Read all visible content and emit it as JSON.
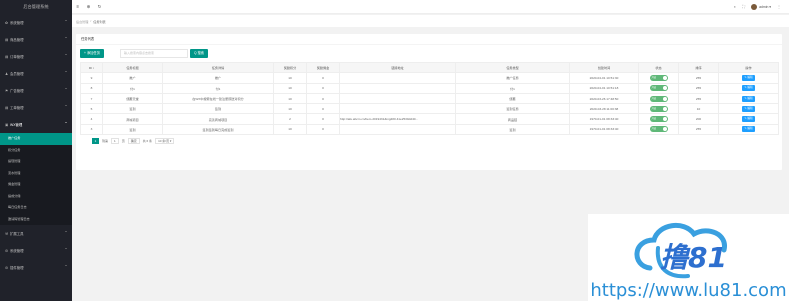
{
  "sidebar": {
    "logo": "后台管理系统",
    "items": [
      {
        "label": "系统管理",
        "icon": "gear-icon",
        "glyph": "✿"
      },
      {
        "label": "商品管理",
        "icon": "chart-icon",
        "glyph": "▤"
      },
      {
        "label": "订单管理",
        "icon": "order-icon",
        "glyph": "▤"
      },
      {
        "label": "会员管理",
        "icon": "user-icon",
        "glyph": "♟"
      },
      {
        "label": "广告管理",
        "icon": "flag-icon",
        "glyph": "⚑"
      },
      {
        "label": "工单管理",
        "icon": "ticket-icon",
        "glyph": "▤"
      },
      {
        "label": "WX管理",
        "icon": "wechat-icon",
        "glyph": "▣"
      }
    ],
    "sub_items": [
      "推广任务",
      "积分任务",
      "提现管理",
      "流水管理",
      "佣金管理",
      "提成分佣",
      "每日任务日志",
      "邀请码管理日志"
    ],
    "items_after": [
      {
        "label": "扩展工具",
        "icon": "wrench-icon",
        "glyph": "⚒"
      },
      {
        "label": "系统管理",
        "icon": "settings-icon",
        "glyph": "⚙"
      },
      {
        "label": "插件管理",
        "icon": "plugin-icon",
        "glyph": "⚙"
      }
    ]
  },
  "header": {
    "menu_icon": "≡",
    "globe_icon": "⊕",
    "refresh_icon": "↻",
    "right_icon1": "◐",
    "right_icon2": "⛶",
    "user": "admin ▾",
    "more": "⋮"
  },
  "breadcrumb": [
    "后台管理",
    "任务列表"
  ],
  "card": {
    "title": "任务列表",
    "add_button": "+ 添加任务",
    "search_placeholder": "输入搜索内容点击搜索",
    "search_button": "Q 搜索"
  },
  "table": {
    "columns": [
      "ID ↕",
      "任务标题",
      "任务详情",
      "奖励积分",
      "奖励佣金",
      "链接地址",
      "任务类型",
      "创建时间",
      "状态",
      "排序",
      "操作"
    ],
    "rows": [
      {
        "id": "9",
        "title": "推广",
        "detail": "推广",
        "points": "10",
        "commission": "0",
        "link": "",
        "type": "推广任务",
        "created": "2020-04-01 10:51:30",
        "status": "开启",
        "sort": "255",
        "op": "✎ 编辑"
      },
      {
        "id": "8",
        "title": "付1",
        "detail": "付1",
        "points": "10",
        "commission": "0",
        "link": "",
        "type": "付1",
        "created": "2020-04-01 10:51:18",
        "status": "开启",
        "sort": "255",
        "op": "✎ 编辑"
      },
      {
        "id": "7",
        "title": "储蓄天堂",
        "detail": "在WX中搜索在线一建注册即送对积分",
        "points": "10",
        "commission": "0",
        "link": "",
        "type": "储蓄",
        "created": "2020-03-26 17:48:50",
        "status": "开启",
        "sort": "255",
        "op": "✎ 编辑"
      },
      {
        "id": "5",
        "title": "签到",
        "detail": "签到",
        "points": "10",
        "commission": "0",
        "link": "",
        "type": "签到任务",
        "created": "2020-03-28 11:00:38",
        "status": "开启",
        "sort": "10",
        "op": "✎ 编辑"
      },
      {
        "id": "4",
        "title": "商城项目",
        "detail": "完善商城项目",
        "points": "2",
        "commission": "0",
        "link": "http://afe.abcm.cn/item-2019431&ing4#0.41e2530dd40...",
        "type": "商品链",
        "created": "1970-01-01 08:33:40",
        "status": "开启",
        "sort": "200",
        "op": "✎ 编辑"
      },
      {
        "id": "3",
        "title": "签到",
        "detail": "签到签到每日完成签到",
        "points": "10",
        "commission": "0",
        "link": "",
        "type": "签到",
        "created": "1970-01-01 08:33:40",
        "status": "开启",
        "sort": "255",
        "op": "✎ 编辑"
      }
    ]
  },
  "pager": {
    "current": "1",
    "goto_label": "到第",
    "page_value": "1",
    "page_suffix": "页",
    "confirm": "确定",
    "total": "共 6 条",
    "page_size": "10 条/页 ▾"
  },
  "watermark": {
    "text": "撸81",
    "url": "https://www.lu81.com"
  },
  "colors": {
    "accent": "#009688",
    "sidebar": "#20222a",
    "switch_on": "#5fb878",
    "edit": "#1e9fff"
  }
}
